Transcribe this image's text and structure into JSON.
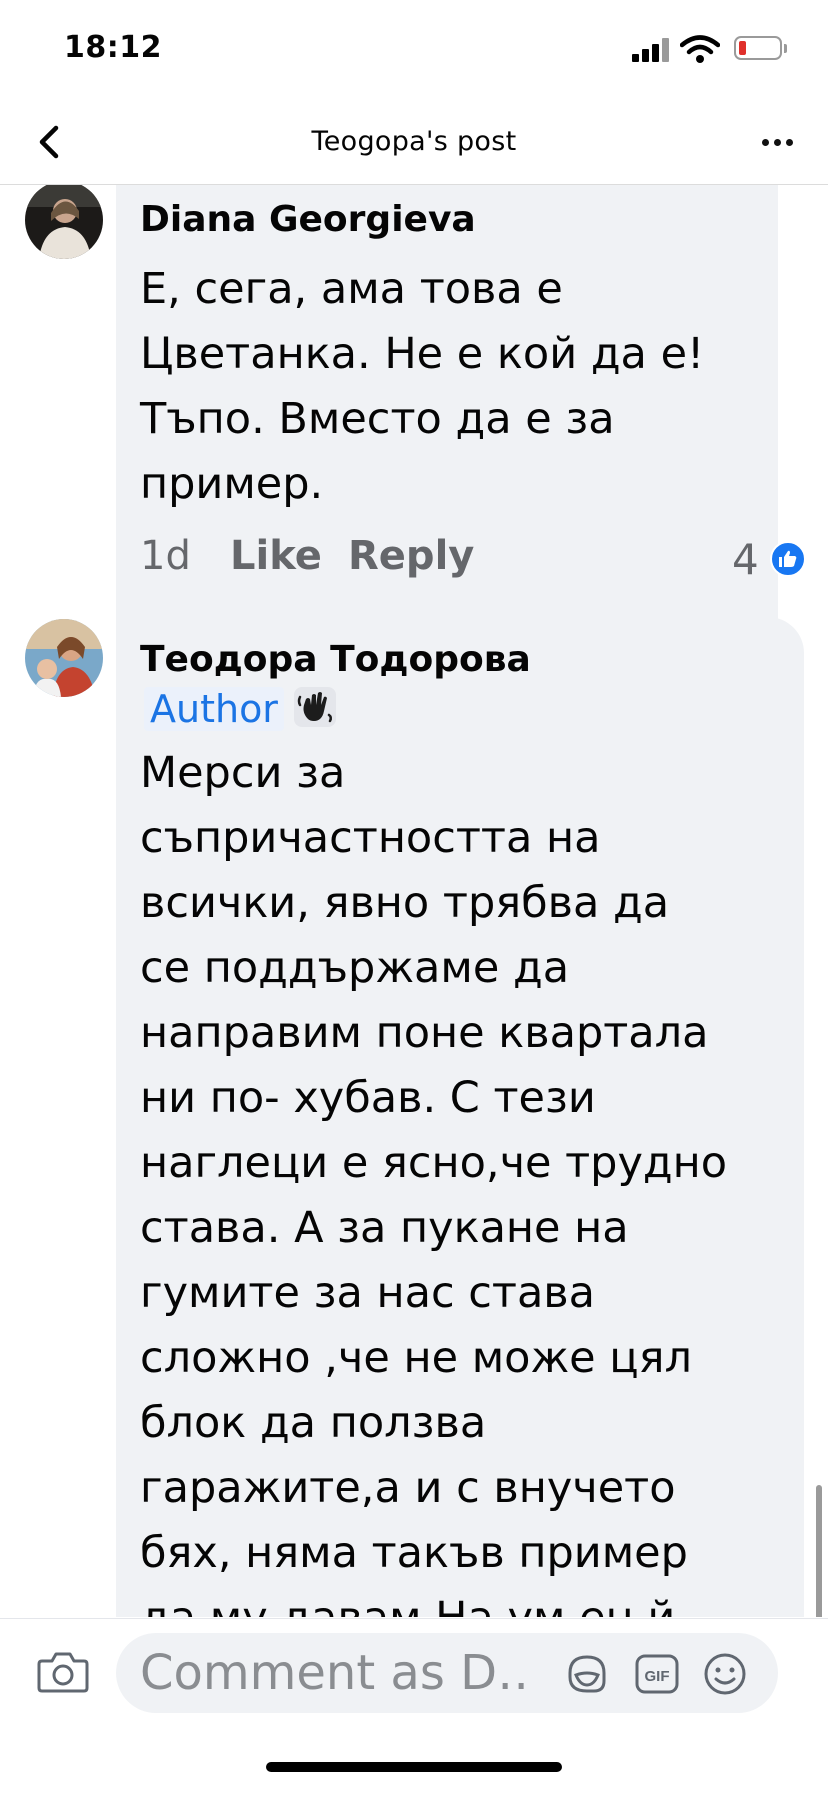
{
  "status_bar": {
    "time": "18:12"
  },
  "header": {
    "title": "Teogopa's post"
  },
  "comments": [
    {
      "author": "Diana Georgieva",
      "text": "Е, сега, ама това е\nЦветанка. Не е кой да е!\nТъпо. Вместо да е за\nпример.",
      "time": "1d",
      "like_label": "Like",
      "reply_label": "Reply",
      "reaction_count": "4"
    },
    {
      "author": "Теодора Тодорова",
      "badge": "Author",
      "badge_icon": "waving-hand-icon",
      "text": "Мерси за\nсъпричастността на\nвсички, явно трябва да\nсе поддържаме да\nнаправим поне  квартала\nни по- хубав. С тези\nнаглеци е ясно,че трудно\nстава. А за пукане на\nгумите за нас става\nсложно ,че не може цял\nблок да ползва\nгаражите,а и с внучето\nбях, няма такъв пример\nда му давам.На ум ен й"
    }
  ],
  "composer": {
    "placeholder": "Comment as D…",
    "icons": [
      "camera-icon",
      "sticker-icon",
      "gif-icon",
      "emoji-icon"
    ],
    "gif_label": "GIF"
  },
  "colors": {
    "accent": "#1877f2",
    "bubble": "#f0f2f5",
    "meta_text": "#65676b"
  }
}
